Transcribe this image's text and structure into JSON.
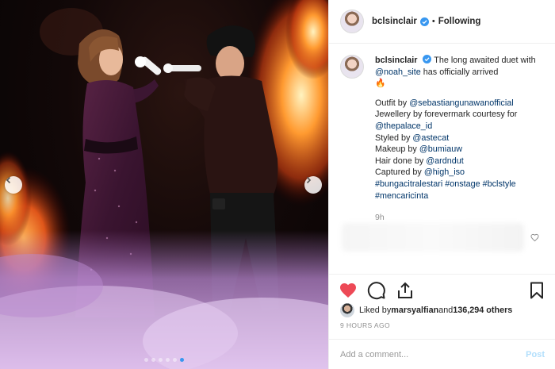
{
  "post": {
    "username": "bclsinclair",
    "follow_state": "Following",
    "separator": "•",
    "caption": {
      "username": "bclsinclair",
      "line1_pre": "The long awaited duet with ",
      "line1_mention": "@noah_site",
      "line1_post": " has officially arrived",
      "emoji": "🔥",
      "outfit_label": "Outfit by ",
      "outfit_mention": "@sebastiangunawanofficial",
      "jewellery_text": "Jewellery by forevermark courtesy for",
      "jewellery_mention": "@thepalace_id",
      "styled_label": "Styled by ",
      "styled_mention": "@astecat",
      "makeup_label": "Makeup by ",
      "makeup_mention": "@bumiauw",
      "hair_label": "Hair done by ",
      "hair_mention": "@ardndut",
      "captured_label": "Captured by ",
      "captured_mention": "@high_iso",
      "hashtags_line1": "#bungacitralestari #onstage #bclstyle",
      "hashtags_line2": "#mencaricinta"
    },
    "time_ago": "9h",
    "liked_by_label": "Liked by ",
    "liked_by_user": "marsyalfian",
    "liked_by_and": " and ",
    "liked_by_others": "136,294 others",
    "posted": "9 HOURS AGO",
    "comment_placeholder": "Add a comment...",
    "post_label": "Post",
    "carousel": {
      "count": 6,
      "active_index": 5
    }
  },
  "colors": {
    "accent": "#3897f0",
    "like_red": "#ed4956",
    "mention": "#003569",
    "post_disabled": "#b2dffc"
  },
  "icons": [
    "verified-badge-icon",
    "heart-icon",
    "comment-icon",
    "share-icon",
    "bookmark-icon",
    "chevron-left-icon",
    "chevron-right-icon"
  ]
}
